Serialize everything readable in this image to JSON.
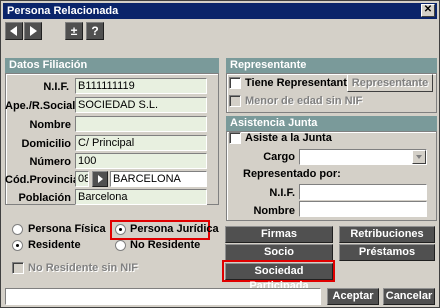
{
  "window": {
    "title": "Persona Relacionada",
    "close_glyph": "✕"
  },
  "toolbar": {
    "prev_icon": "arrow-left-icon",
    "next_icon": "arrow-right-icon",
    "sum_label": "±",
    "help_label": "?"
  },
  "datos": {
    "header": "Datos Filiación",
    "nif_label": "N.I.F.",
    "nif_value": "B111111119",
    "razon_label": "Ape./R.Social",
    "razon_value": "SOCIEDAD S.L.",
    "nombre_label": "Nombre",
    "nombre_value": "",
    "domicilio_label": "Domicilio",
    "domicilio_value": "C/ Principal",
    "numero_label": "Número",
    "numero_value": "100",
    "cp_label": "Cód.Provincial",
    "cp_value": "08",
    "provincia_value": "BARCELONA",
    "poblacion_label": "Población",
    "poblacion_value": "Barcelona"
  },
  "tipo": {
    "fisica_label": "Persona Física",
    "juridica_label": "Persona Jurídica",
    "residente_label": "Residente",
    "no_residente_label": "No Residente",
    "no_res_nif_label": "No Residente sin NIF"
  },
  "representante": {
    "header": "Representante",
    "tiene_label": "Tiene Representante",
    "btn_label": "Representante",
    "menor_label": "Menor de edad sin NIF"
  },
  "asistencia": {
    "header": "Asistencia Junta",
    "asiste_label": "Asiste a la Junta",
    "cargo_label": "Cargo",
    "representado_label": "Representado por:",
    "nif_label": "N.I.F.",
    "nombre_label": "Nombre"
  },
  "actions": {
    "firmas": "Firmas",
    "retribuciones": "Retribuciones",
    "socio": "Socio",
    "prestamos": "Préstamos",
    "sociedad": "Sociedad Participada"
  },
  "footer": {
    "aceptar": "Aceptar",
    "cancelar": "Cancelar"
  },
  "colors": {
    "title_bg": "#0a246a",
    "section_bg": "#7a9a9a",
    "dark_button": "#505050",
    "highlight": "#e00000",
    "field_bg": "#e8f0e0"
  }
}
